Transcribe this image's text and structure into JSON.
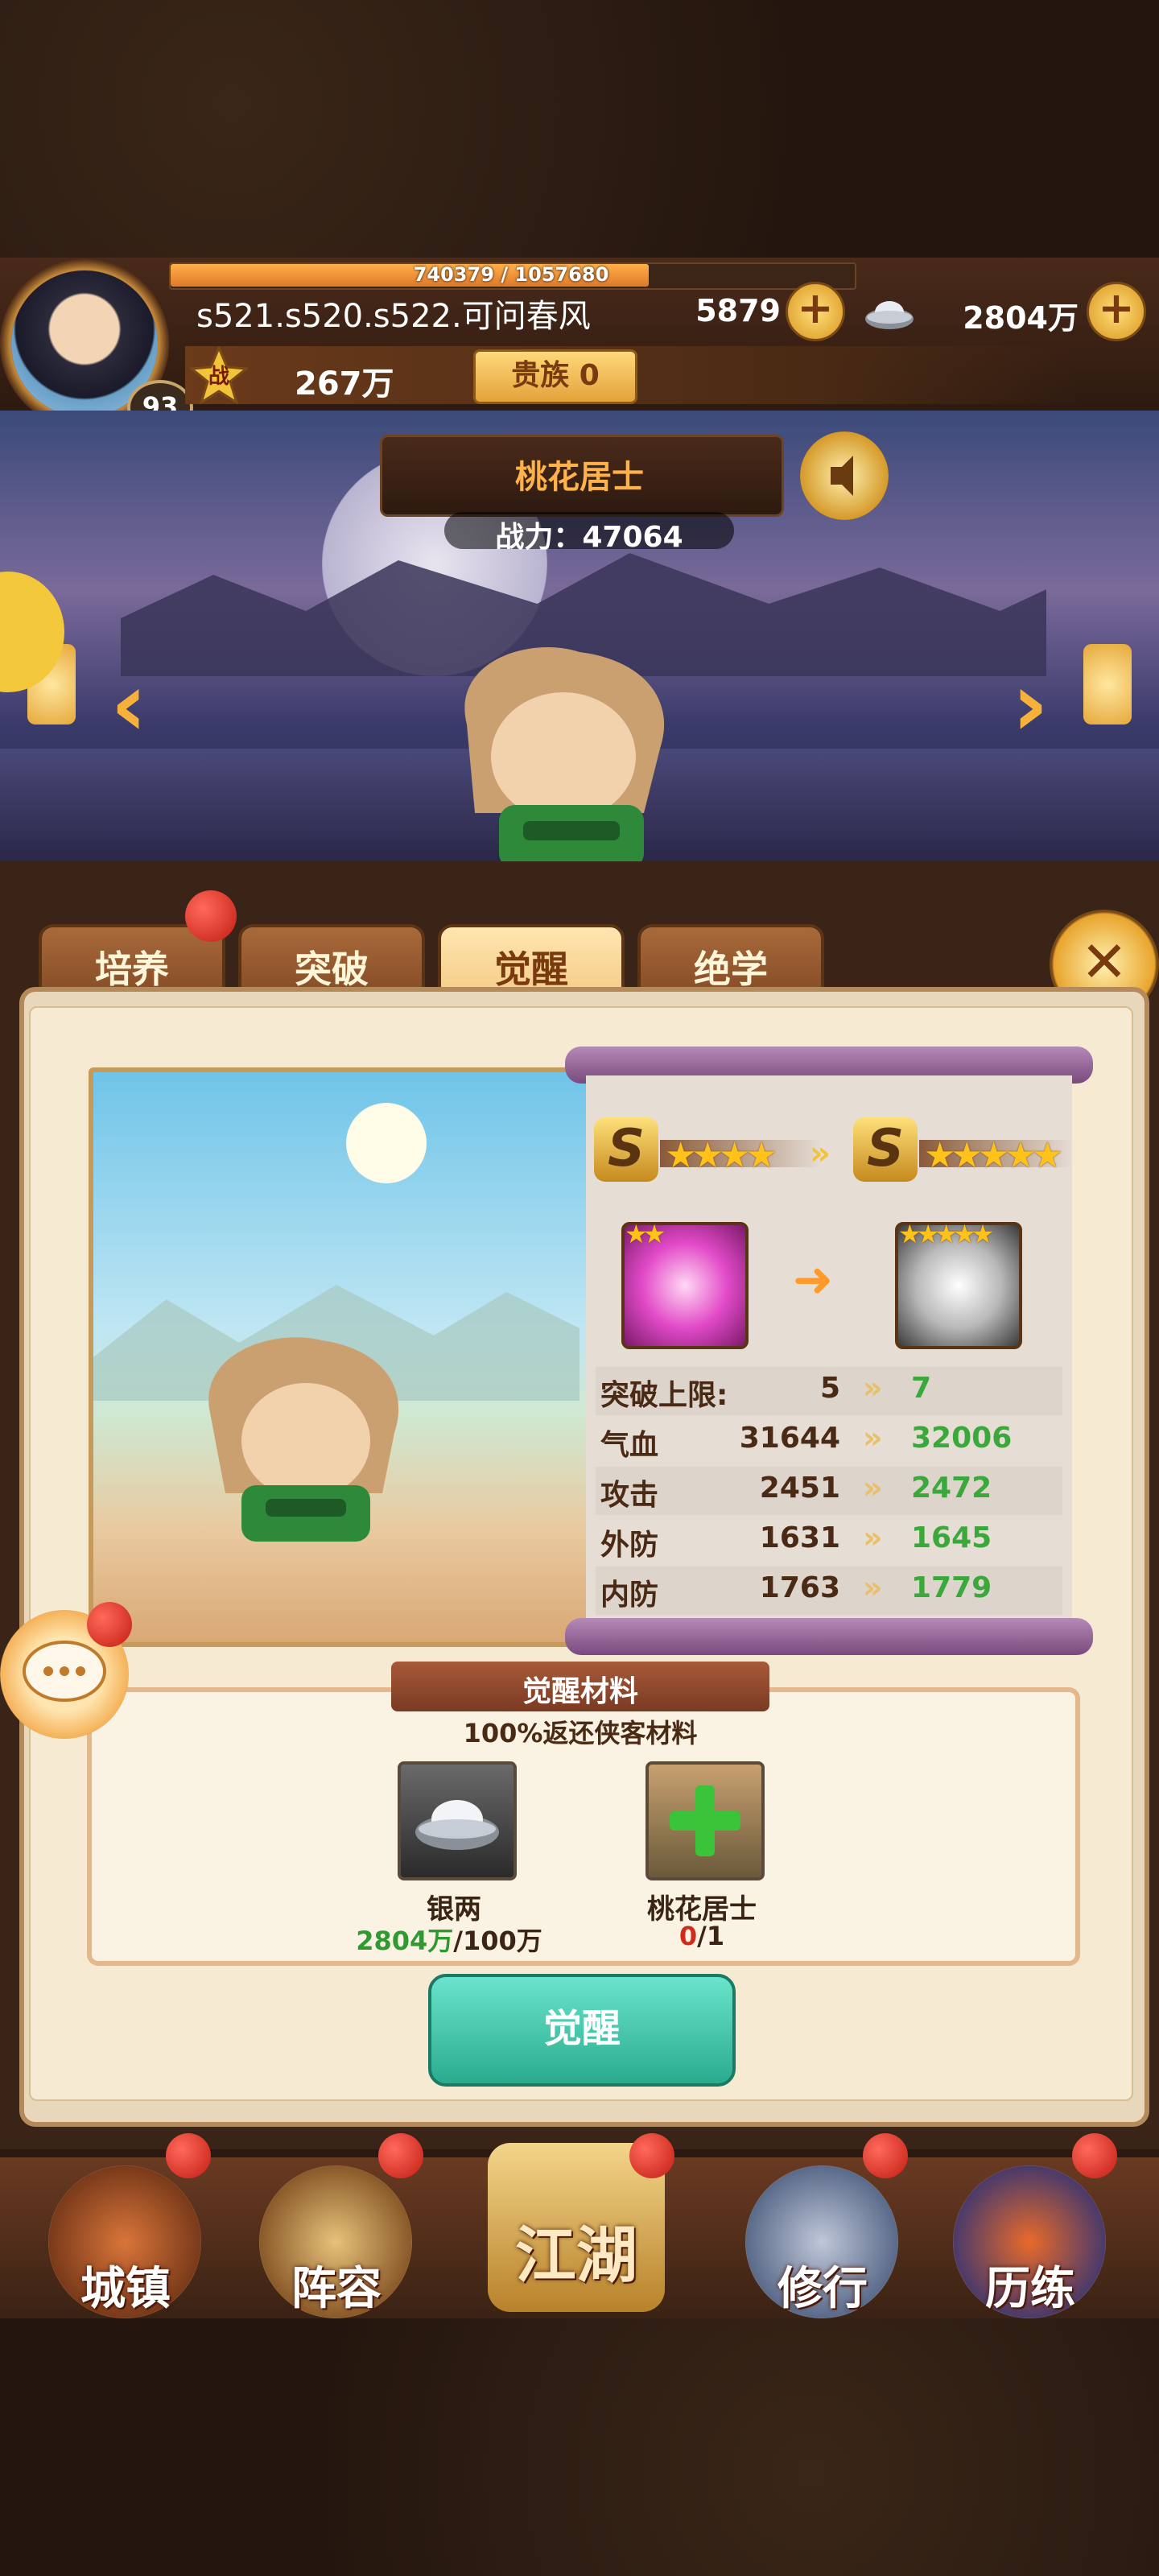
{
  "header": {
    "exp_text": "740379 / 1057680",
    "exp_fraction": 0.7,
    "player_name": "s521.s520.s522.可问春风",
    "level": "93",
    "gold": "5879",
    "silver": "2804万",
    "power_icon_label": "战",
    "power": "267万",
    "noble": "贵族 0"
  },
  "hero": {
    "name": "桃花居士",
    "power": "战力：47064"
  },
  "tabs": [
    {
      "label": "培养"
    },
    {
      "label": "突破"
    },
    {
      "label": "觉醒"
    },
    {
      "label": "绝学"
    }
  ],
  "awaken": {
    "grade_letter": "S",
    "current_stars": "★★★★",
    "next_stars": "★★★★★",
    "current_item_stars": "★★",
    "next_item_stars": "★★★★★",
    "stats": [
      {
        "label": "突破上限:",
        "old": "5",
        "new": "7"
      },
      {
        "label": "气血",
        "old": "31644",
        "new": "32006"
      },
      {
        "label": "攻击",
        "old": "2451",
        "new": "2472"
      },
      {
        "label": "外防",
        "old": "1631",
        "new": "1645"
      },
      {
        "label": "内防",
        "old": "1763",
        "new": "1779"
      }
    ]
  },
  "materials": {
    "title": "觉醒材料",
    "subtitle": "100%返还侠客材料",
    "items": [
      {
        "name": "银两",
        "have": "2804万",
        "need": "/100万",
        "have_color": "#2f9a2f"
      },
      {
        "name": "桃花居士",
        "have": "0",
        "need": "/1",
        "have_color": "#d02a1a"
      }
    ]
  },
  "awaken_button": "觉醒",
  "nav": [
    {
      "label": "城镇"
    },
    {
      "label": "阵容"
    },
    {
      "label": "江湖"
    },
    {
      "label": "修行"
    },
    {
      "label": "历练"
    }
  ]
}
